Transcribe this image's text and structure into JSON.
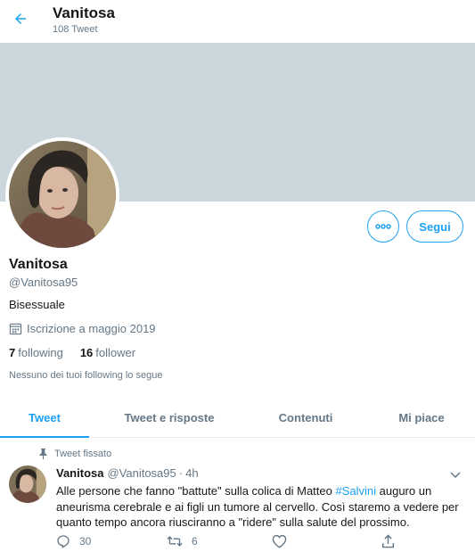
{
  "header": {
    "title": "Vanitosa",
    "tweet_count": "108 Tweet",
    "back_icon": "arrow-left-icon"
  },
  "colors": {
    "accent": "#1da1f2",
    "banner": "#ccd6dd",
    "text": "#14171a",
    "muted": "#657786",
    "divider": "#e6ecf0"
  },
  "profile": {
    "name": "Vanitosa",
    "handle": "@Vanitosa95",
    "bio": "Bisessuale",
    "joined": "Iscrizione a maggio 2019",
    "following_count": "7",
    "following_label": "following",
    "followers_count": "16",
    "followers_label": "follower",
    "followers_note": "Nessuno dei tuoi following lo segue",
    "follow_button": "Segui",
    "more_icon": "more-horizontal-icon"
  },
  "tabs": [
    {
      "label": "Tweet",
      "active": true
    },
    {
      "label": "Tweet e risposte",
      "active": false
    },
    {
      "label": "Contenuti",
      "active": false
    },
    {
      "label": "Mi piace",
      "active": false
    }
  ],
  "tweet": {
    "pinned_label": "Tweet fissato",
    "name": "Vanitosa",
    "handle": "@Vanitosa95",
    "dot": "·",
    "time": "4h",
    "text_before": "Alle persone che fanno \"battute\" sulla colica di Matteo ",
    "hashtag": "#Salvini",
    "text_after": " auguro un aneurisma cerebrale e ai figli un tumore al cervello. Così staremo a vedere per quanto tempo ancora riusciranno a \"ridere\" sulla salute del prossimo.",
    "replies": "30",
    "retweets": "6",
    "likes": "",
    "icons": [
      "reply-icon",
      "retweet-icon",
      "like-icon",
      "share-icon"
    ]
  }
}
